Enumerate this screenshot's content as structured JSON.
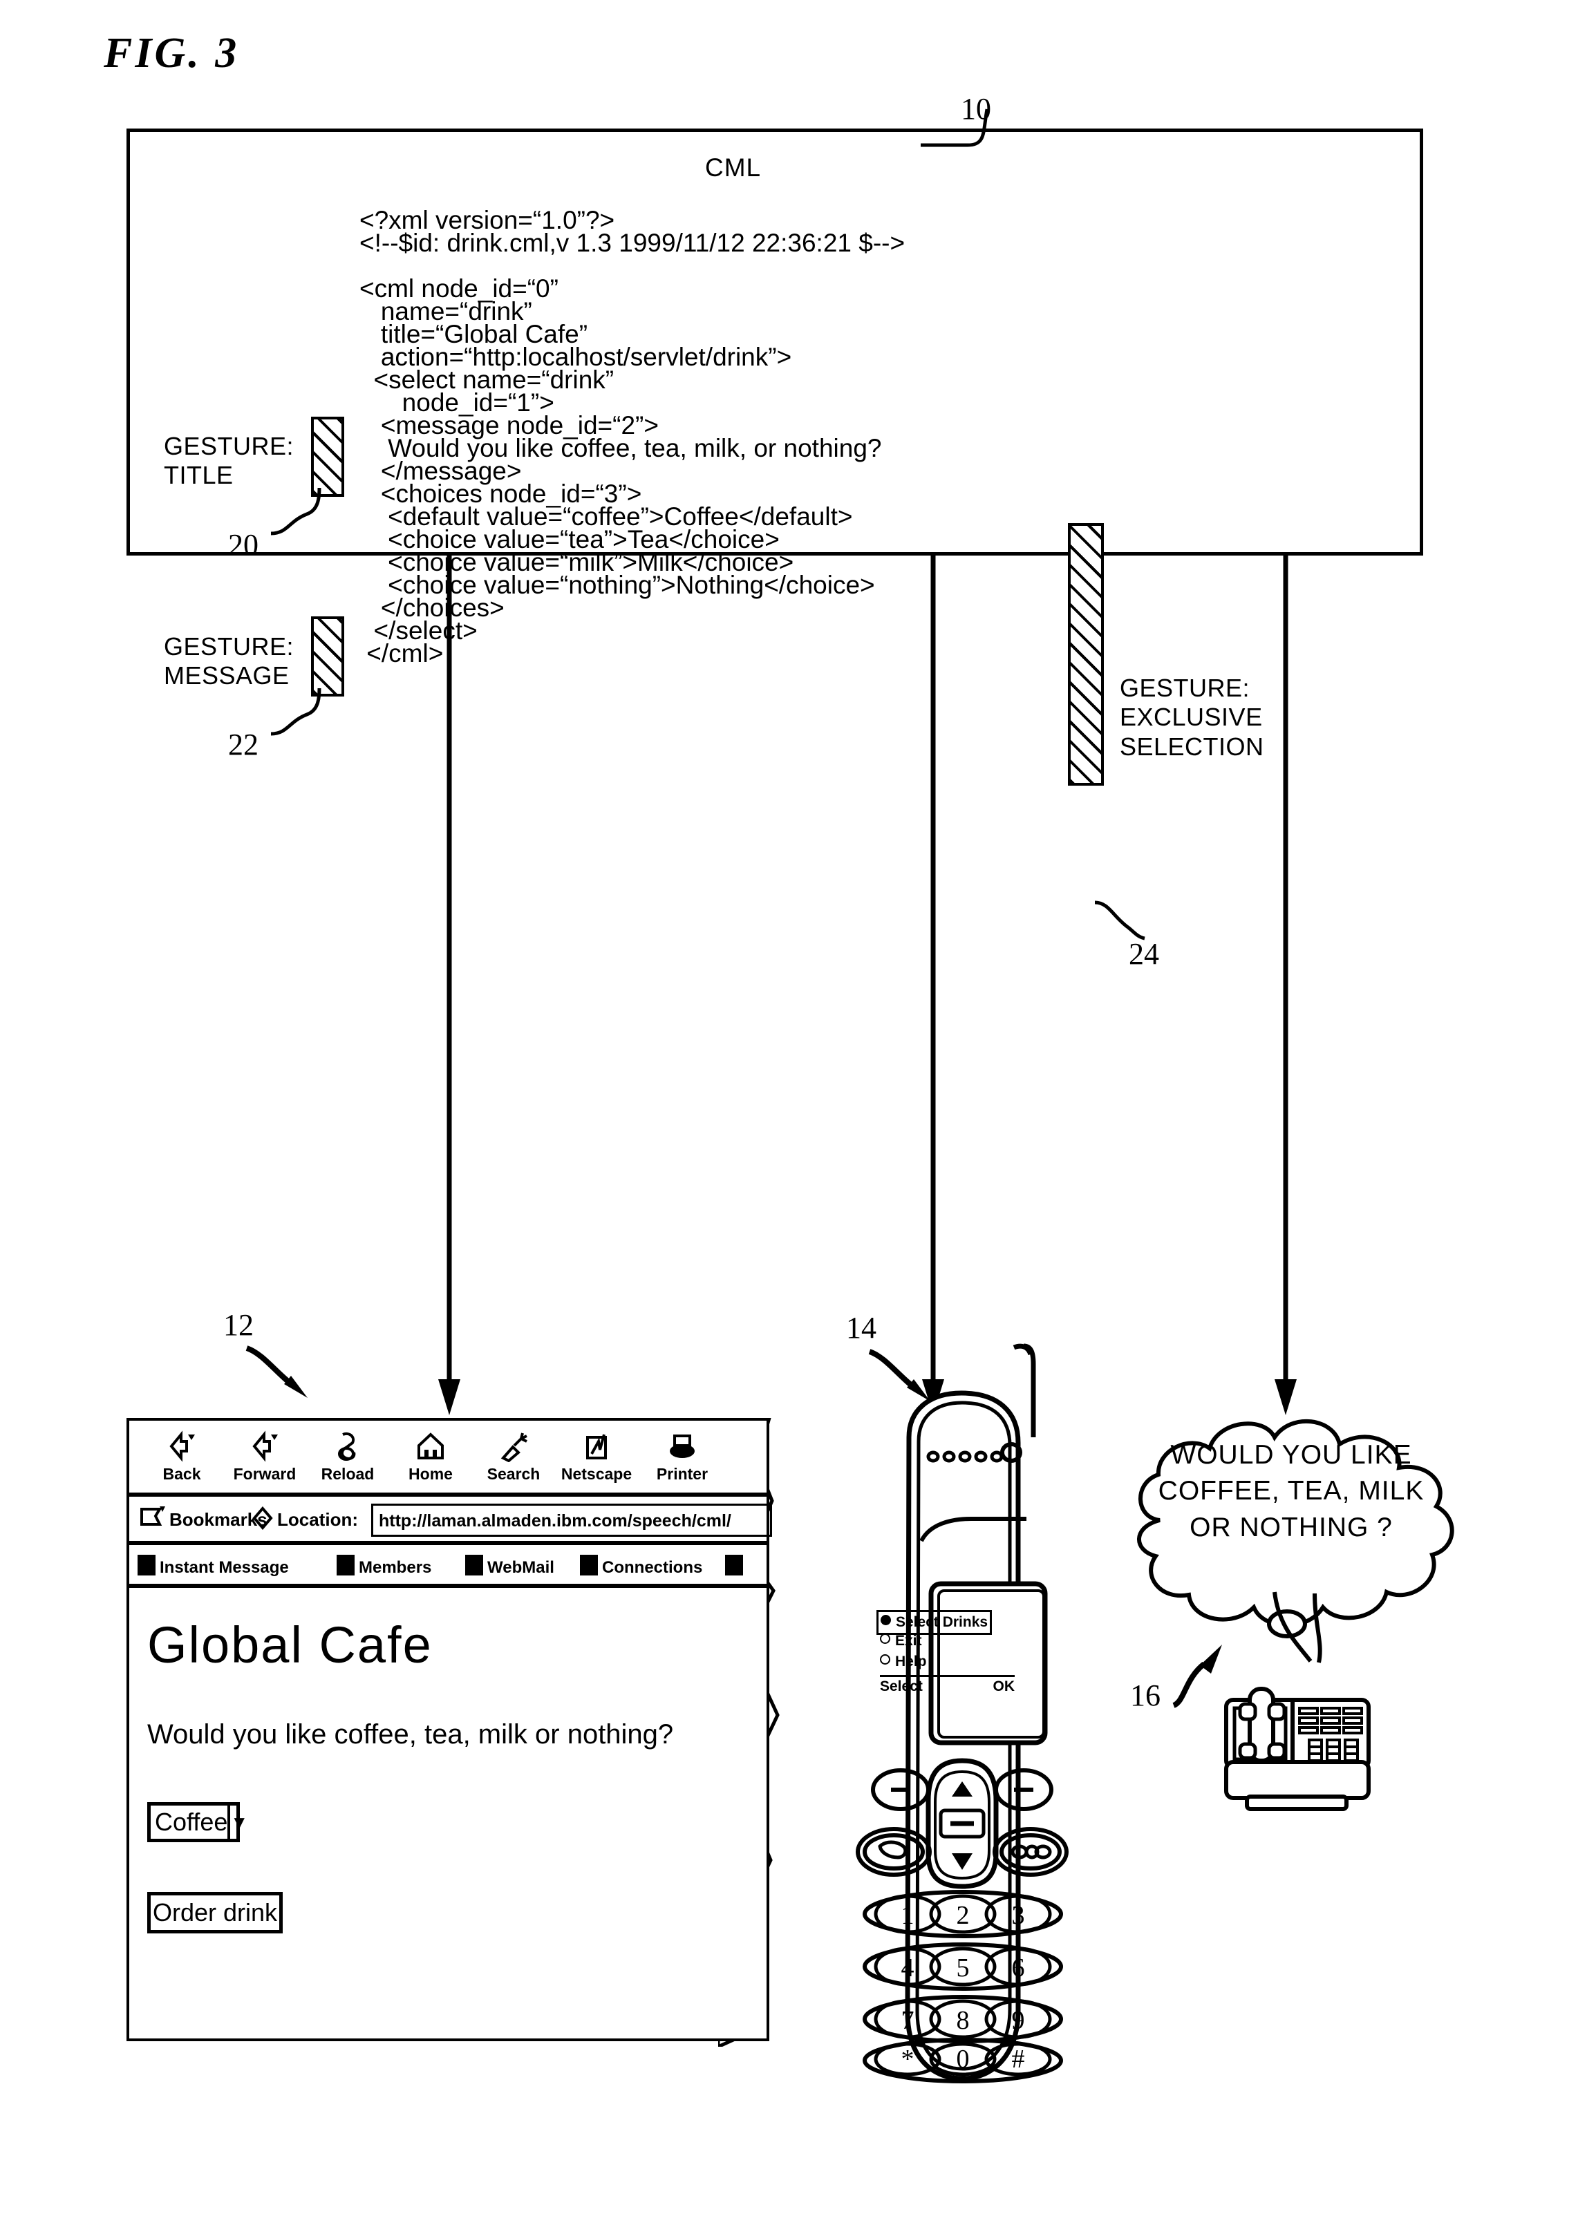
{
  "figure": {
    "caption": "FIG. 3",
    "ref_10": "10",
    "ref_12": "12",
    "ref_14": "14",
    "ref_16": "16",
    "ref_20": "20",
    "ref_22": "22",
    "ref_24": "24"
  },
  "cml_panel": {
    "title": "CML",
    "code_lines": [
      "<?xml version=“1.0”?>",
      "<!--$id: drink.cml,v 1.3 1999/11/12 22:36:21 $-->",
      "",
      "<cml node_id=“0”",
      "   name=“drink”",
      "   title=“Global Cafe”",
      "   action=“http:localhost/servlet/drink”>",
      "  <select name=“drink”",
      "      node_id=“1”>",
      "   <message node_id=“2”>",
      "    Would you like coffee, tea, milk, or nothing?",
      "   </message>",
      "   <choices node_id=“3”>",
      "    <default value=“coffee”>Coffee</default>",
      "    <choice value=“tea”>Tea</choice>",
      "    <choice value=“milk”>Milk</choice>",
      "    <choice value=“nothing”>Nothing</choice>",
      "   </choices>",
      "  </select>",
      " </cml>"
    ]
  },
  "gestures": [
    {
      "id": "title",
      "line1": "GESTURE:",
      "line2": "TITLE",
      "line3": ""
    },
    {
      "id": "message",
      "line1": "GESTURE:",
      "line2": "MESSAGE",
      "line3": ""
    },
    {
      "id": "exclusive",
      "line1": "GESTURE:",
      "line2": "EXCLUSIVE",
      "line3": "SELECTION"
    }
  ],
  "browser": {
    "toolbar": [
      {
        "label": "Back",
        "icon": "back-arrow-icon"
      },
      {
        "label": "Forward",
        "icon": "forward-arrow-icon"
      },
      {
        "label": "Reload",
        "icon": "reload-icon"
      },
      {
        "label": "Home",
        "icon": "home-icon"
      },
      {
        "label": "Search",
        "icon": "search-flashlight-icon"
      },
      {
        "label": "Netscape",
        "icon": "netscape-icon"
      },
      {
        "label": "Printer",
        "icon": "printer-icon"
      }
    ],
    "bookmarks_label": "Bookmarks",
    "location_label": "Location:",
    "location_value": "http://laman.almaden.ibm.com/speech/cml/",
    "personal_links": [
      {
        "label": "Instant Message",
        "icon": "person-icon"
      },
      {
        "label": "Members",
        "icon": "page-icon"
      },
      {
        "label": "WebMail",
        "icon": "page-icon"
      },
      {
        "label": "Connections",
        "icon": "page-icon"
      },
      {
        "label": "",
        "icon": "page-icon"
      }
    ],
    "page": {
      "title": "Global Cafe",
      "message": "Would you like coffee, tea, milk or nothing?",
      "select_value": "Coffee",
      "select_arrow": "▼",
      "submit_label": "Order drink"
    }
  },
  "phone": {
    "menu": [
      {
        "label": "Select Drinks",
        "selected": true
      },
      {
        "label": "Exit",
        "selected": false
      },
      {
        "label": "Help",
        "selected": false
      }
    ],
    "softkey_left": "Select",
    "softkey_right": "OK",
    "keypad": [
      "1",
      "2",
      "3",
      "4",
      "5",
      "6",
      "7",
      "8",
      "9",
      "*",
      "0",
      "#"
    ]
  },
  "telephone_bubble": {
    "line1": "WOULD YOU LIKE",
    "line2": "COFFEE, TEA, MILK",
    "line3": "OR NOTHING ?"
  }
}
